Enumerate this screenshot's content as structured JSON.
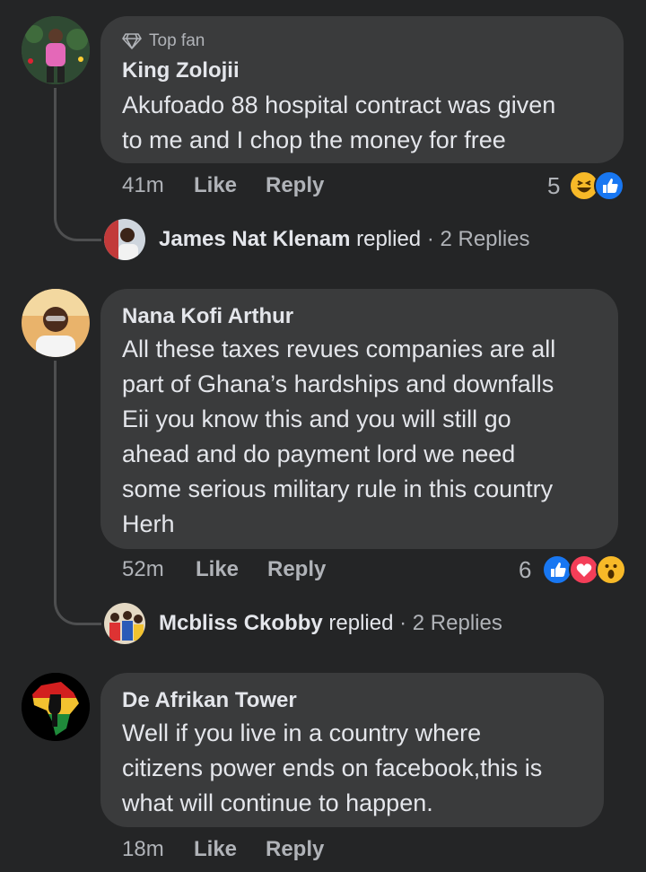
{
  "comments": [
    {
      "badge": "Top fan",
      "author": "King Zolojii",
      "text_lines": [
        "Akufoado 88 hospital contract was given",
        "to me and I chop the money for free"
      ],
      "time": "41m",
      "like_label": "Like",
      "reply_label": "Reply",
      "reaction_count": "5",
      "reactions": [
        "haha-icon",
        "like-icon"
      ],
      "replies": {
        "name": "James Nat Klenam",
        "action": "replied",
        "count": "· 2 Replies"
      }
    },
    {
      "author": "Nana Kofi Arthur",
      "text_lines": [
        "All these taxes revues companies are all",
        "part of Ghana’s hardships and downfalls",
        "Eii you know this and you will still go",
        "ahead and do payment lord we need",
        "some serious military rule in this country",
        "Herh"
      ],
      "time": "52m",
      "like_label": "Like",
      "reply_label": "Reply",
      "reaction_count": "6",
      "reactions": [
        "like-icon",
        "love-icon",
        "wow-icon"
      ],
      "replies": {
        "name": "Mcbliss Ckobby",
        "action": "replied",
        "count": "· 2 Replies"
      }
    },
    {
      "author": "De Afrikan Tower",
      "text_lines": [
        "Well if you live in a country where",
        "citizens power ends on facebook,this is",
        "what will continue to happen."
      ],
      "time": "18m",
      "like_label": "Like",
      "reply_label": "Reply"
    }
  ],
  "colors": {
    "background": "#242526",
    "bubble": "#3a3b3c",
    "text": "#e4e6eb",
    "secondary": "#b0b3b8",
    "like_blue": "#1877f2",
    "love_red": "#f33e58",
    "haha_yellow": "#f7b928"
  }
}
